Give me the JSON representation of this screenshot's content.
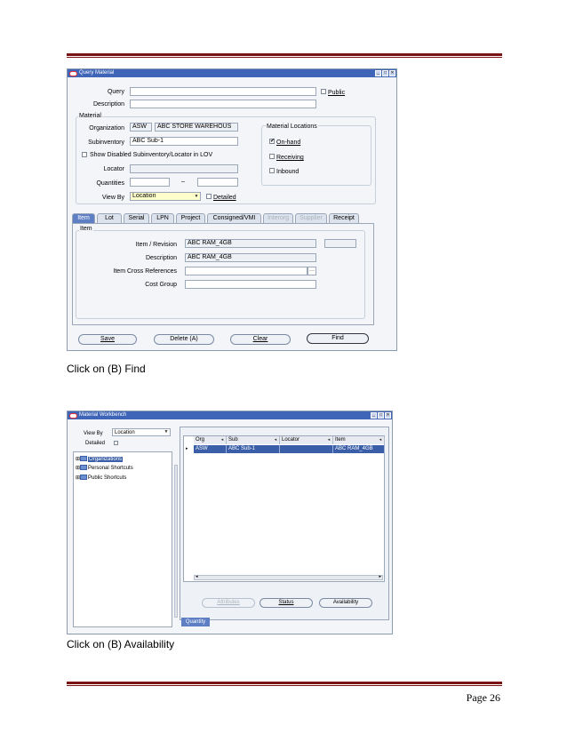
{
  "query_material": {
    "title": "Query Material",
    "query_label": "Query",
    "public_label": "Public",
    "description_label": "Description",
    "material_group": "Material",
    "organization_label": "Organization",
    "organization_code": "ASW",
    "organization_name": "ABC STORE WAREHOUS",
    "subinventory_label": "Subinventory",
    "subinventory_value": "ABC Sub-1",
    "show_disabled_label": "Show Disabled Subinventory/Locator in LOV",
    "locator_label": "Locator",
    "quantities_label": "Quantities",
    "quantities_dash": "–",
    "view_by_label": "View By",
    "view_by_value": "Location",
    "detailed_label": "Detailed",
    "material_locations_group": "Material Locations",
    "onhand_label": "On-hand",
    "receiving_label": "Receiving",
    "inbound_label": "Inbound",
    "tabs": [
      {
        "label": "Item"
      },
      {
        "label": "Lot"
      },
      {
        "label": "Serial"
      },
      {
        "label": "LPN"
      },
      {
        "label": "Project"
      },
      {
        "label": "Consigned/VMI"
      },
      {
        "label": "Interorg"
      },
      {
        "label": "Supplier"
      },
      {
        "label": "Receipt"
      }
    ],
    "item_group": "Item",
    "item_revision_label": "Item / Revision",
    "item_revision_value": "ABC RAM_4GB",
    "item_description_label": "Description",
    "item_description_value": "ABC RAM_4GB",
    "cross_ref_label": "Item Cross References",
    "cost_group_label": "Cost Group",
    "buttons": {
      "save": "Save",
      "delete": "Delete (A)",
      "clear": "Clear",
      "find": "Find"
    }
  },
  "caption_1": "Click on (B) Find",
  "material_workbench": {
    "title": "Material Workbench",
    "view_by_label": "View By",
    "view_by_value": "Location",
    "detailed_label": "Detailed",
    "tree": [
      {
        "label": "Organizations"
      },
      {
        "label": "Personal Shortcuts"
      },
      {
        "label": "Public Shortcuts"
      }
    ],
    "columns": [
      "Org",
      "Sub",
      "Locator",
      "Item"
    ],
    "rows": [
      {
        "org": "ASW",
        "sub": "ABC Sub-1",
        "locator": "",
        "item": "ABC RAM_4GB"
      }
    ],
    "buttons": {
      "attributes": "Attributes",
      "status": "Status",
      "availability": "Availability"
    },
    "bottom_tab": "Quantity"
  },
  "caption_2": "Click on (B) Availability",
  "footer": "Page 26",
  "colors": {
    "rule": "#7a1414",
    "titlebar": "#3f65b8",
    "selection": "#3a5fa8"
  }
}
